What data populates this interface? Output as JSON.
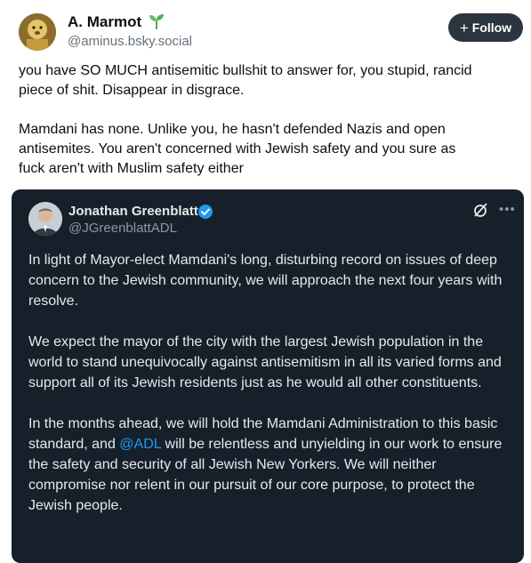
{
  "post": {
    "author_name": "A. Marmot",
    "author_handle": "@aminus.bsky.social",
    "follow_label": "Follow",
    "paragraphs": [
      "you have SO MUCH antisemitic bullshit to answer for, you stupid, rancid\npiece of shit. Disappear in disgrace.",
      "Mamdani has none. Unlike you, he hasn't defended Nazis and open\nantisemites. You aren't concerned with Jewish safety and you sure as\nfuck aren't with Muslim safety either"
    ]
  },
  "quote": {
    "author_name": "Jonathan Greenblatt",
    "author_handle": "@JGreenblattADL",
    "paragraphs": [
      "In light of Mayor-elect Mamdani's long, disturbing record on issues of deep concern to the Jewish community, we will approach the next four years with resolve.",
      "We expect the mayor of the city with the largest Jewish population in the world to stand unequivocally against antisemitism in all its varied forms and support all of its Jewish residents just as he would all other constituents."
    ],
    "last_paragraph_before": "In the months ahead, we will hold the Mamdani Administration to this basic standard, and ",
    "mention": "@ADL",
    "last_paragraph_after": " will be relentless and unyielding in our work to ensure the safety and security of all Jewish New Yorkers. We will neither compromise nor relent in our pursuit of our core purpose, to protect the Jewish people."
  },
  "icons": {
    "author_badge": "seedling-icon",
    "verified": "verified-badge-icon",
    "grok": "grok-icon",
    "more": "more-options-icon"
  },
  "colors": {
    "follow_bg": "#2b3540",
    "quote_bg": "#15202b",
    "mention": "#1d9bf0",
    "verified": "#1d9bf0",
    "badge_green": "#4caf50"
  }
}
